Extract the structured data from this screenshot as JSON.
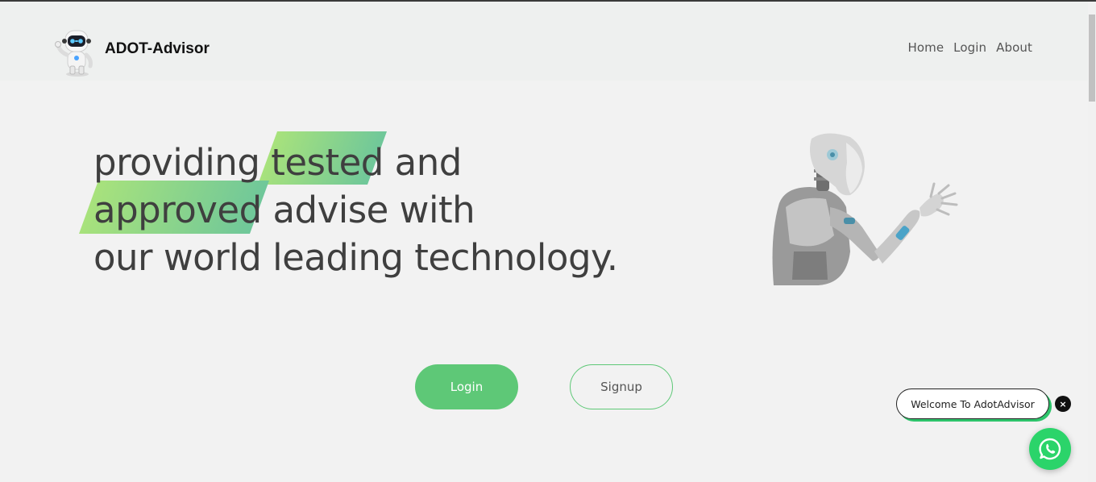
{
  "header": {
    "brand_name": "ADOT-Advisor",
    "nav": [
      {
        "label": "Home"
      },
      {
        "label": "Login"
      },
      {
        "label": "About"
      }
    ]
  },
  "hero": {
    "lines": [
      [
        "providing ",
        "tested",
        " and"
      ],
      [
        "approved",
        " advise with"
      ],
      [
        "our world leading technology."
      ]
    ],
    "highlight_colors": [
      "#a8e27c",
      "#6fc79a"
    ]
  },
  "actions": {
    "login_label": "Login",
    "signup_label": "Signup",
    "accent": "#5ec877"
  },
  "chat_widget": {
    "message": "Welcome To AdotAdvisor",
    "close_glyph": "×",
    "icon": "whatsapp-icon",
    "color": "#2bd46a"
  },
  "icons": {
    "brand_logo": "robot-mascot-icon",
    "hero_art": "humanoid-robot-illustration"
  }
}
